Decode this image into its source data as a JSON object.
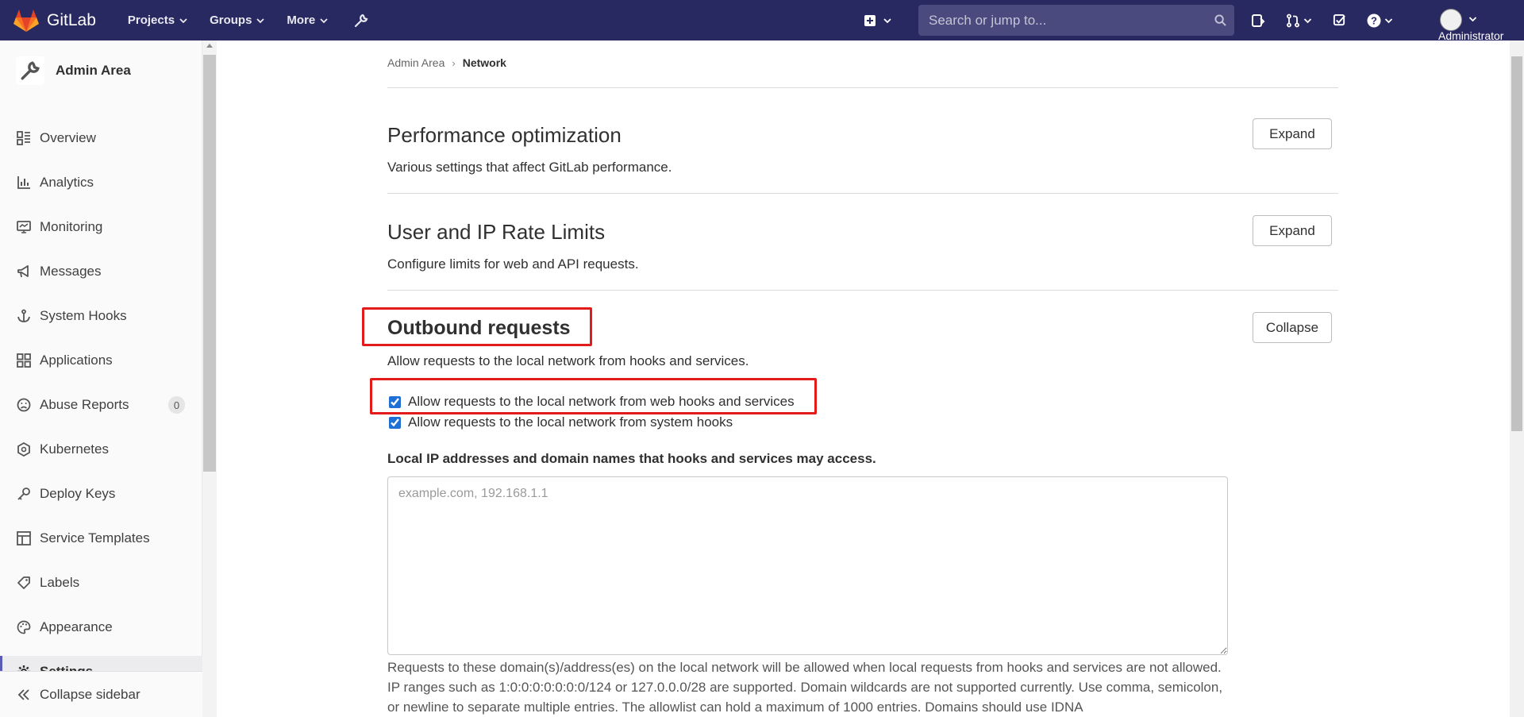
{
  "navbar": {
    "brand": "GitLab",
    "menu": [
      {
        "label": "Projects",
        "icon": "chevron-down-icon"
      },
      {
        "label": "Groups",
        "icon": "chevron-down-icon"
      },
      {
        "label": "More",
        "icon": "chevron-down-icon"
      }
    ],
    "admin_icon": "wrench-icon",
    "search_placeholder": "Search or jump to...",
    "user_name": "Administrator",
    "bg_color": "#292961"
  },
  "sidebar": {
    "context_title": "Admin Area",
    "items": [
      {
        "label": "Overview",
        "icon": "overview-icon"
      },
      {
        "label": "Analytics",
        "icon": "analytics-icon"
      },
      {
        "label": "Monitoring",
        "icon": "monitor-icon"
      },
      {
        "label": "Messages",
        "icon": "megaphone-icon"
      },
      {
        "label": "System Hooks",
        "icon": "anchor-icon"
      },
      {
        "label": "Applications",
        "icon": "applications-icon"
      },
      {
        "label": "Abuse Reports",
        "icon": "frown-icon",
        "badge": "0"
      },
      {
        "label": "Kubernetes",
        "icon": "kubernetes-icon"
      },
      {
        "label": "Deploy Keys",
        "icon": "key-icon"
      },
      {
        "label": "Service Templates",
        "icon": "template-icon"
      },
      {
        "label": "Labels",
        "icon": "label-icon"
      },
      {
        "label": "Appearance",
        "icon": "palette-icon"
      },
      {
        "label": "Settings",
        "icon": "settings-icon",
        "active": true
      }
    ],
    "collapse_label": "Collapse sidebar"
  },
  "breadcrumb": [
    "Admin Area",
    "Network"
  ],
  "sections": {
    "performance": {
      "title": "Performance optimization",
      "description": "Various settings that affect GitLab performance.",
      "button": "Expand"
    },
    "rate_limits": {
      "title": "User and IP Rate Limits",
      "description": "Configure limits for web and API requests.",
      "button": "Expand"
    },
    "outbound": {
      "title": "Outbound requests",
      "description": "Allow requests to the local network from hooks and services.",
      "button": "Collapse",
      "checkboxes": [
        {
          "label": "Allow requests to the local network from web hooks and services",
          "checked": true
        },
        {
          "label": "Allow requests to the local network from system hooks",
          "checked": true
        }
      ],
      "allowlist_label": "Local IP addresses and domain names that hooks and services may access.",
      "allowlist_placeholder": "example.com, 192.168.1.1",
      "help_text": "Requests to these domain(s)/address(es) on the local network will be allowed when local requests from hooks and services are not allowed. IP ranges such as 1:0:0:0:0:0:0:0/124 or 127.0.0.0/28 are supported. Domain wildcards are not supported currently. Use comma, semicolon, or newline to separate multiple entries. The allowlist can hold a maximum of 1000 entries. Domains should use IDNA"
    }
  },
  "highlight_color": "#e41b1b"
}
